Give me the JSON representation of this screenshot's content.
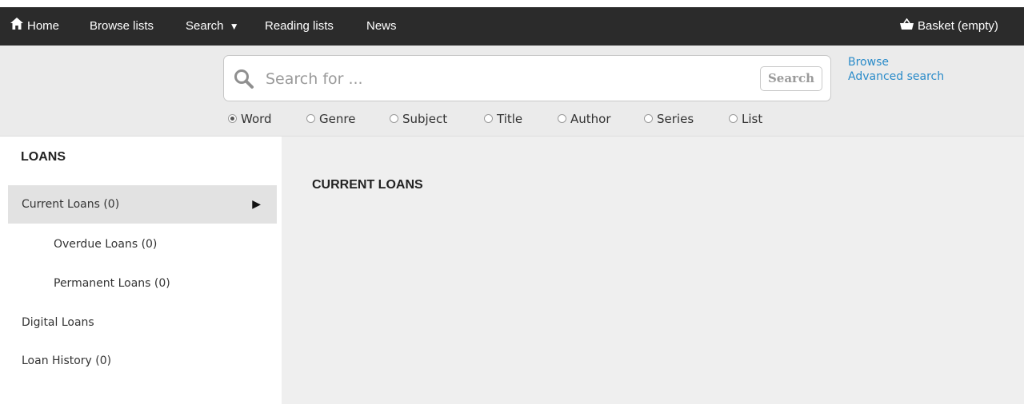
{
  "nav": {
    "home": "Home",
    "browse_lists": "Browse lists",
    "search": "Search",
    "reading_lists": "Reading lists",
    "news": "News",
    "basket": "Basket (empty)"
  },
  "search": {
    "placeholder": "Search for ...",
    "button": "Search",
    "links": {
      "browse": "Browse",
      "advanced": "Advanced search"
    },
    "options": [
      "Word",
      "Genre",
      "Subject",
      "Title",
      "Author",
      "Series",
      "List"
    ],
    "selected": "Word"
  },
  "sidebar": {
    "heading": "LOANS",
    "items": [
      {
        "label": "Current Loans (0)"
      },
      {
        "label": "Overdue Loans (0)"
      },
      {
        "label": "Permanent Loans (0)"
      },
      {
        "label": "Digital Loans"
      },
      {
        "label": "Loan History (0)"
      }
    ]
  },
  "content": {
    "title": "CURRENT LOANS"
  },
  "colors": {
    "navbar": "#2b2b2b",
    "link": "#2a8bc9",
    "active_item": "#e2e2e2",
    "content_bg": "#efefef"
  }
}
